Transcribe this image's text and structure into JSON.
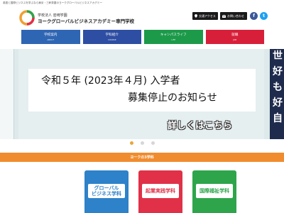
{
  "header": {
    "tagline": "英語と国際ビジネスを学ぶなら東京・三軒茶屋のヨークグローバルビジネスアカデミー",
    "org": "学校法人 岩崎学園",
    "school_name": "ヨークグローバルビジネスアカデミー専門学校",
    "access_label": "交通アクセス",
    "inquiry_label": "お問い合わせ",
    "facebook_glyph": "f",
    "twitter_glyph": "t"
  },
  "nav": [
    {
      "label": "学校案内",
      "sub": "ABOUT",
      "color": "#2f66b4"
    },
    {
      "label": "学科紹介",
      "sub": "COURSE",
      "color": "#2d4ea2"
    },
    {
      "label": "キャンパスライフ",
      "sub": "LIFE",
      "color": "#1c9a4a"
    },
    {
      "label": "就職",
      "sub": "JOB",
      "color": "#d81f3a"
    }
  ],
  "hero": {
    "line1": "令和５年 (2023年４月) 入学者",
    "line2": "募集停止のお知らせ",
    "details": "詳しくはこちら",
    "side_chars": [
      "世",
      "好",
      "も",
      "好",
      "自"
    ]
  },
  "slider": {
    "count": 3,
    "active_index": 0
  },
  "section": {
    "title": "ヨークの3学科"
  },
  "departments": [
    {
      "label": "グローバル\nビジネス学科",
      "color": "#2e82c9",
      "text_color": "#2e82c9"
    },
    {
      "label": "起業実践学科",
      "color": "#e03148",
      "text_color": "#e03148"
    },
    {
      "label": "国際福祉学科",
      "color": "#2ea54b",
      "text_color": "#2ea54b"
    }
  ]
}
